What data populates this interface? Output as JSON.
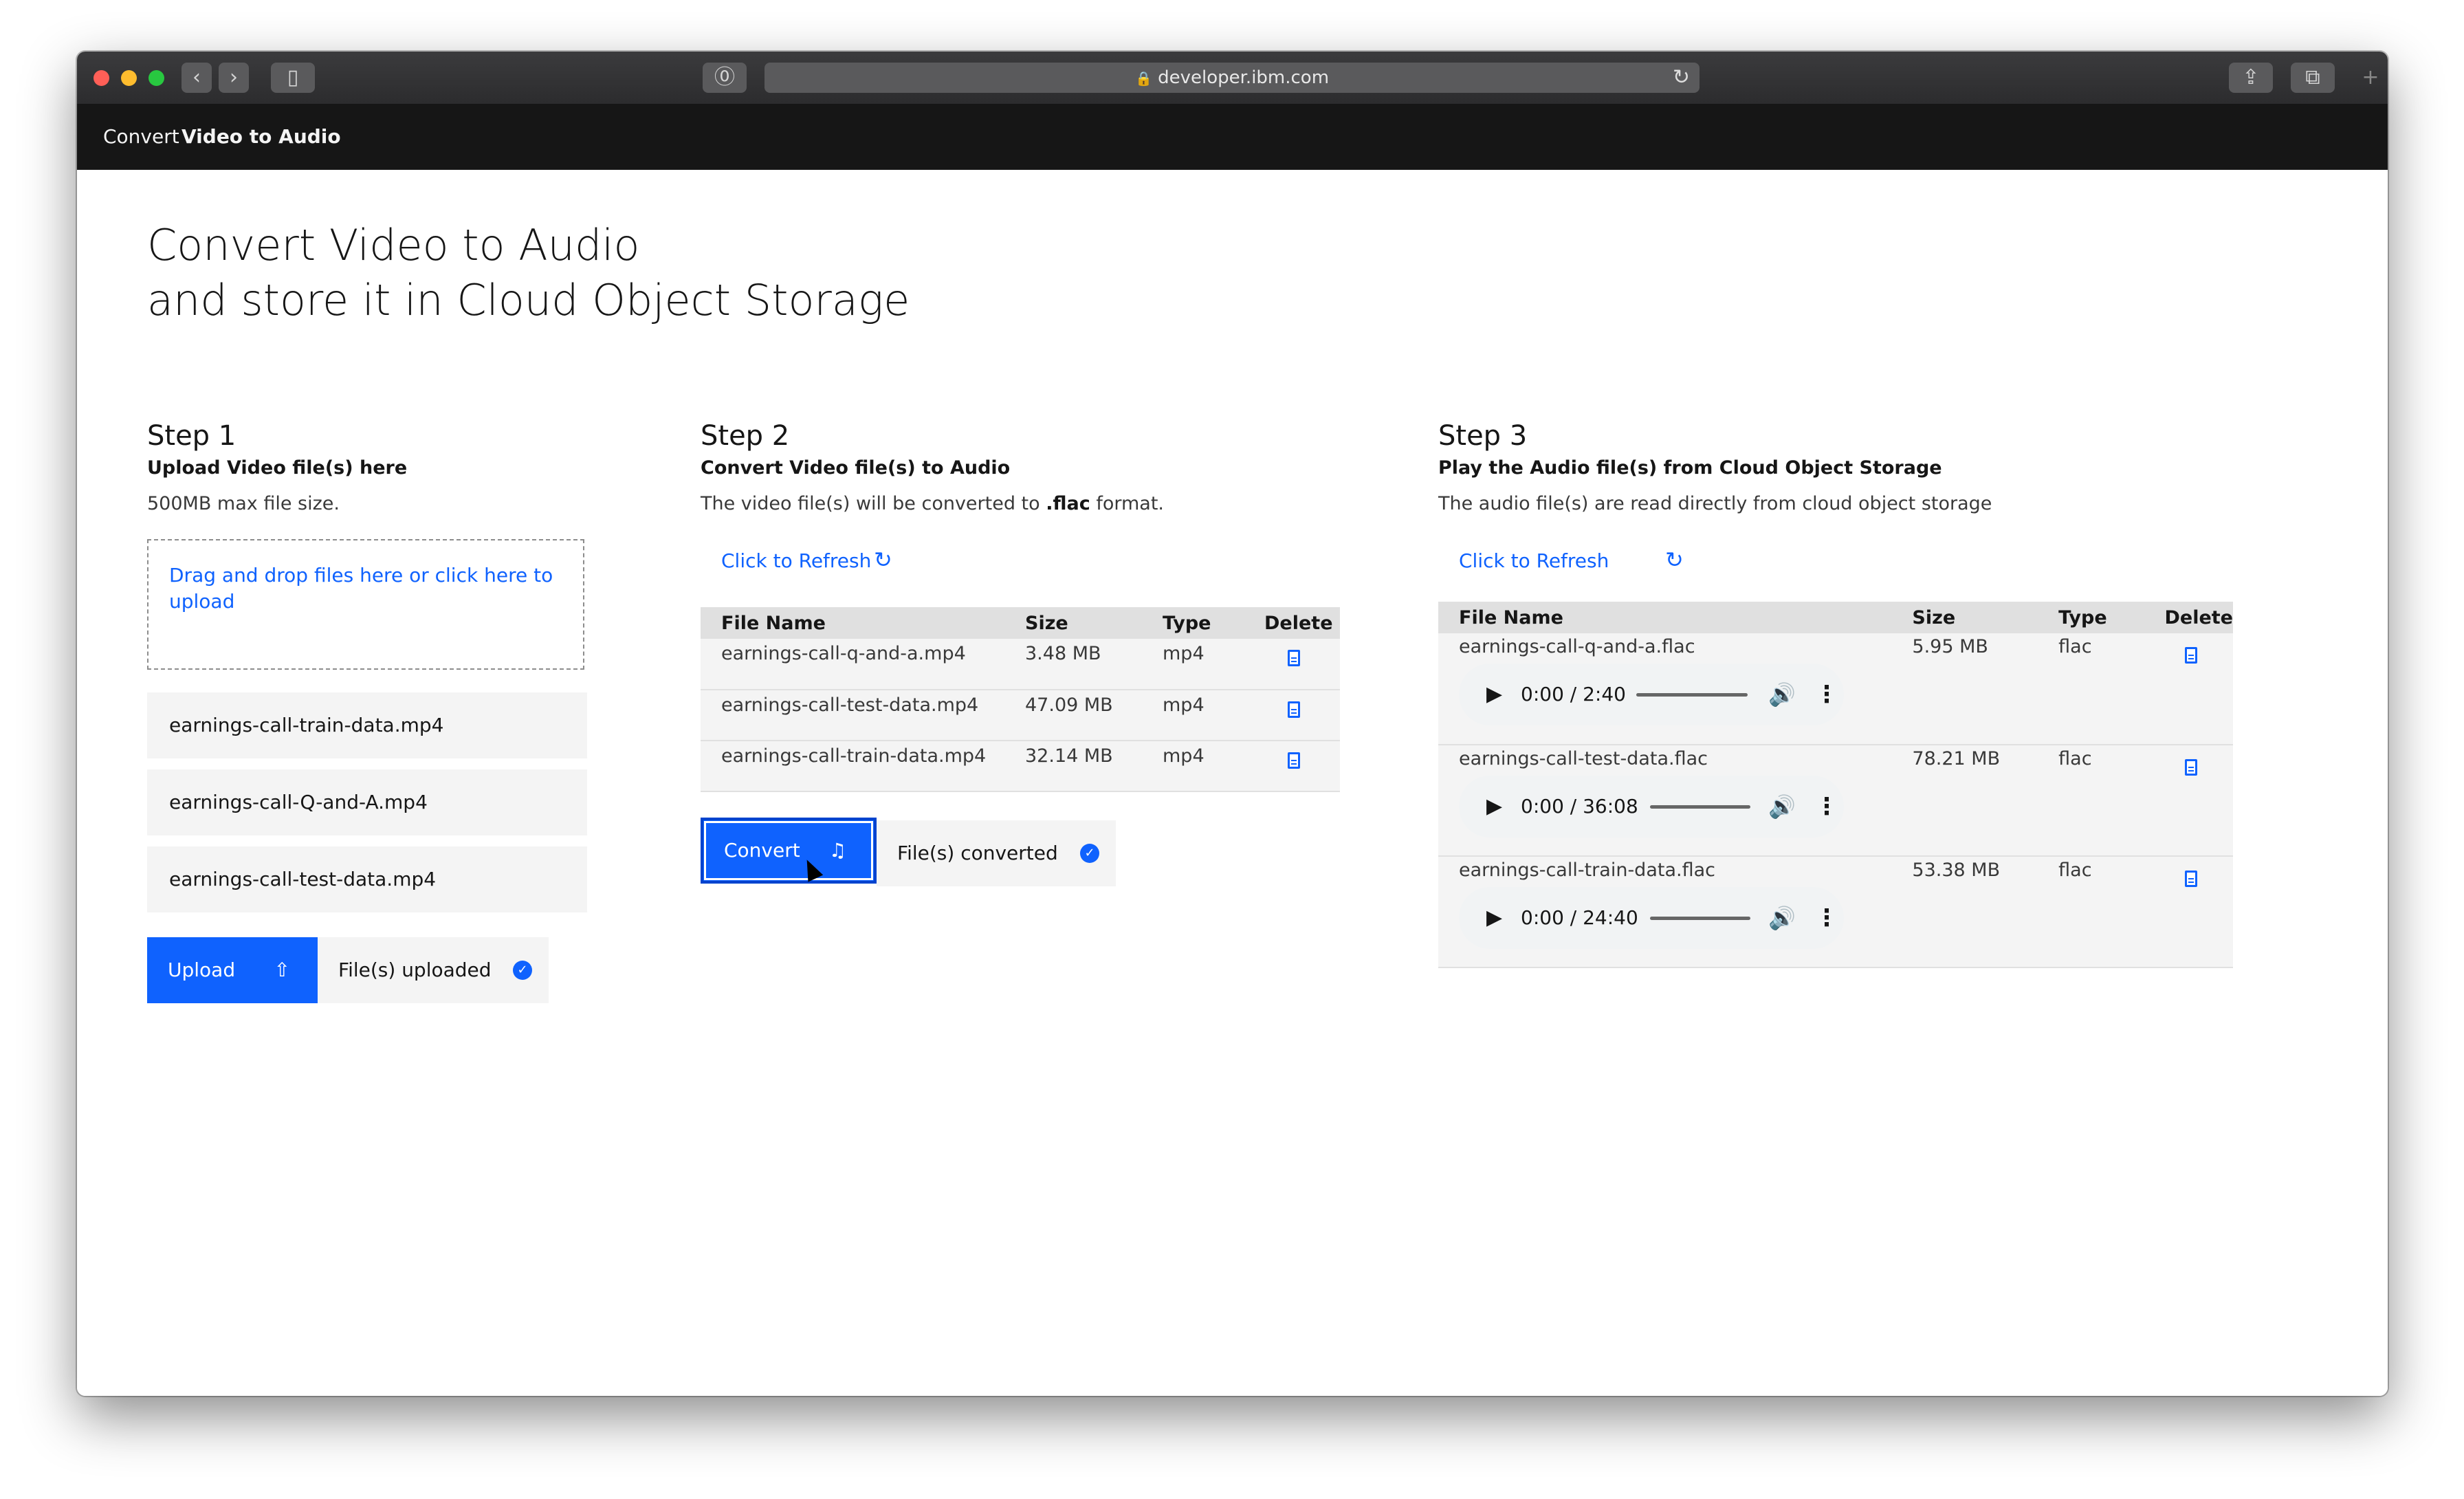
{
  "browser": {
    "url": "developer.ibm.com",
    "back_glyph": "‹",
    "forward_glyph": "›",
    "reload_glyph": "↻",
    "lock_glyph": "🔒",
    "reader_glyph": "⓪",
    "share_glyph": "⇪",
    "tabs_glyph": "⧉",
    "plus_glyph": "+"
  },
  "header": {
    "prefix": "Convert",
    "name": "Video to Audio"
  },
  "page": {
    "title_line1": "Convert Video to Audio",
    "title_line2": "and store it in Cloud Object Storage"
  },
  "step1": {
    "title": "Step 1",
    "subtitle": "Upload Video file(s) here",
    "description": "500MB max file size.",
    "dropzone_text": "Drag and drop files here or click here to upload",
    "files": [
      "earnings-call-train-data.mp4",
      "earnings-call-Q-and-A.mp4",
      "earnings-call-test-data.mp4"
    ],
    "upload_label": "Upload",
    "upload_icon": "⇧",
    "status_label": "File(s) uploaded",
    "check_glyph": "✓"
  },
  "step2": {
    "title": "Step 2",
    "subtitle": "Convert Video file(s) to Audio",
    "description_prefix": "The video file(s) will be converted to ",
    "description_format": ".flac",
    "description_suffix": " format.",
    "refresh_label": "Click to Refresh",
    "refresh_glyph": "↻",
    "columns": [
      "File Name",
      "Size",
      "Type",
      "Delete"
    ],
    "rows": [
      {
        "name": "earnings-call-q-and-a.mp4",
        "size": "3.48 MB",
        "type": "mp4"
      },
      {
        "name": "earnings-call-test-data.mp4",
        "size": "47.09 MB",
        "type": "mp4"
      },
      {
        "name": "earnings-call-train-data.mp4",
        "size": "32.14 MB",
        "type": "mp4"
      }
    ],
    "convert_label": "Convert",
    "convert_icon": "♫",
    "status_label": "File(s) converted",
    "check_glyph": "✓"
  },
  "step3": {
    "title": "Step 3",
    "subtitle": "Play the Audio file(s) from Cloud Object Storage",
    "description": "The audio file(s) are read directly from cloud object storage",
    "refresh_label": "Click to Refresh",
    "refresh_glyph": "↻",
    "columns": [
      "File Name",
      "Size",
      "Type",
      "Delete"
    ],
    "rows": [
      {
        "name": "earnings-call-q-and-a.flac",
        "size": "5.95 MB",
        "type": "flac",
        "time": "0:00 / 2:40"
      },
      {
        "name": "earnings-call-test-data.flac",
        "size": "78.21 MB",
        "type": "flac",
        "time": "0:00 / 36:08"
      },
      {
        "name": "earnings-call-train-data.flac",
        "size": "53.38 MB",
        "type": "flac",
        "time": "0:00 / 24:40"
      }
    ],
    "play_glyph": "▶",
    "volume_glyph": "🔊",
    "more_glyph": "⋮"
  },
  "colors": {
    "accent": "#0f62fe",
    "header_bg": "#161616",
    "row_bg": "#f4f4f4",
    "table_head_bg": "#e0e0e0"
  }
}
